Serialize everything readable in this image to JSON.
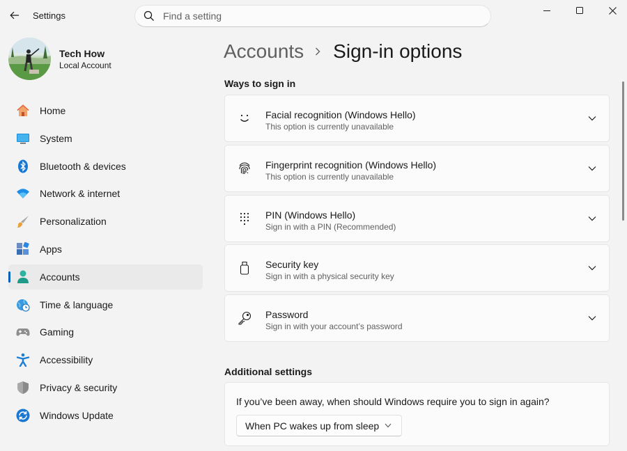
{
  "app": {
    "title": "Settings"
  },
  "search": {
    "placeholder": "Find a setting",
    "value": ""
  },
  "profile": {
    "name": "Tech How",
    "account_type": "Local Account"
  },
  "nav": {
    "items": [
      {
        "label": "Home",
        "icon": "home-icon",
        "selected": false
      },
      {
        "label": "System",
        "icon": "system-icon",
        "selected": false
      },
      {
        "label": "Bluetooth & devices",
        "icon": "bluetooth-icon",
        "selected": false
      },
      {
        "label": "Network & internet",
        "icon": "wifi-icon",
        "selected": false
      },
      {
        "label": "Personalization",
        "icon": "brush-icon",
        "selected": false
      },
      {
        "label": "Apps",
        "icon": "apps-icon",
        "selected": false
      },
      {
        "label": "Accounts",
        "icon": "person-icon",
        "selected": true
      },
      {
        "label": "Time & language",
        "icon": "globe-clock-icon",
        "selected": false
      },
      {
        "label": "Gaming",
        "icon": "gamepad-icon",
        "selected": false
      },
      {
        "label": "Accessibility",
        "icon": "accessibility-icon",
        "selected": false
      },
      {
        "label": "Privacy & security",
        "icon": "shield-icon",
        "selected": false
      },
      {
        "label": "Windows Update",
        "icon": "update-icon",
        "selected": false
      }
    ]
  },
  "breadcrumb": {
    "parent": "Accounts",
    "current": "Sign-in options"
  },
  "ways_to_sign_in": {
    "title": "Ways to sign in",
    "options": [
      {
        "title": "Facial recognition (Windows Hello)",
        "description": "This option is currently unavailable",
        "icon": "face-icon"
      },
      {
        "title": "Fingerprint recognition (Windows Hello)",
        "description": "This option is currently unavailable",
        "icon": "fingerprint-icon"
      },
      {
        "title": "PIN (Windows Hello)",
        "description": "Sign in with a PIN (Recommended)",
        "icon": "pin-keypad-icon"
      },
      {
        "title": "Security key",
        "description": "Sign in with a physical security key",
        "icon": "usb-key-icon"
      },
      {
        "title": "Password",
        "description": "Sign in with your account’s password",
        "icon": "key-icon"
      }
    ]
  },
  "additional_settings": {
    "title": "Additional settings",
    "require_signin_question": "If you’ve been away, when should Windows require you to sign in again?",
    "require_signin_value": "When PC wakes up from sleep"
  },
  "colors": {
    "accent": "#005fb8",
    "background": "#f3f3f3",
    "card": "#fbfbfb"
  }
}
